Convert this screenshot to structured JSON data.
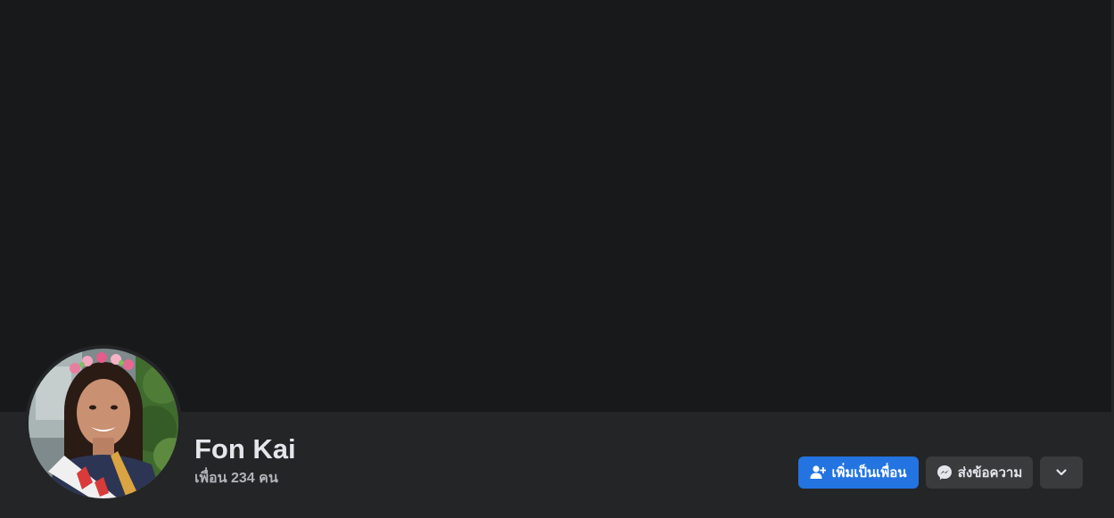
{
  "profile": {
    "name": "Fon Kai",
    "friends_text": "เพื่อน 234 คน"
  },
  "actions": {
    "add_friend_label": "เพิ่มเป็นเพื่อน",
    "message_label": "ส่งข้อความ",
    "add_friend_icon": "person-add-icon",
    "message_icon": "messenger-icon",
    "more_icon": "chevron-down-icon"
  },
  "colors": {
    "background": "#18191a",
    "surface": "#242526",
    "primary_button": "#2374e1",
    "secondary_button": "#3a3b3c",
    "primary_text": "#e4e6eb",
    "secondary_text": "#b0b3b8"
  }
}
